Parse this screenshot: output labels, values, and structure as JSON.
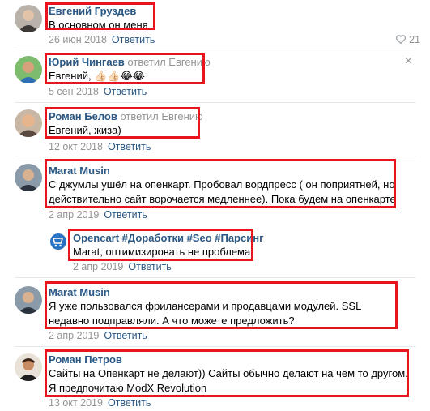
{
  "comments": [
    {
      "author": "Евгений Груздев",
      "reply_to": "",
      "text": "В основном он меня",
      "date": "26 июн 2018",
      "action": "Ответить",
      "likes": "21"
    },
    {
      "author": "Юрий Чингаев",
      "reply_to": "ответил Евгению",
      "text": "Евгений,",
      "emojis": [
        "👍🏻",
        "👍🏻",
        "😂",
        "😂"
      ],
      "date": "5 сен 2018",
      "action": "Ответить",
      "close": "×"
    },
    {
      "author": "Роман Белов",
      "reply_to": "ответил Евгению",
      "text": "Евгений, жиза)",
      "date": "12 окт 2018",
      "action": "Ответить"
    },
    {
      "author": "Marat Musin",
      "reply_to": "",
      "text": "С джумлы ушёл на опенкарт. Пробовал вордпресс ( он поприятней, но действительно сайт ворочается медленнее). Пока будем на опенкарте",
      "date": "2 апр 2019",
      "action": "Ответить"
    },
    {
      "author": "Opencart #Доработки #Seo #Парсинг",
      "reply_to": "",
      "text": "Marat, оптимизировать не проблема",
      "date": "2 апр 2019",
      "action": "Ответить"
    },
    {
      "author": "Marat Musin",
      "reply_to": "",
      "text": "Я уже пользовался фрилансерами и продавцами модулей. SSL недавно подправляли. А что можете предложить?",
      "date": "2 апр 2019",
      "action": "Ответить"
    },
    {
      "author": "Роман Петров",
      "reply_to": "",
      "text": "Сайты на Опенкарт не делают)) Сайты обычно делают на чём то другом. Я предпочитаю ModX Revolution",
      "date": "13 окт 2019",
      "action": "Ответить"
    }
  ],
  "colors": {
    "link": "#2a5885",
    "meta": "#939393",
    "highlight": "#e8141e",
    "divider": "#e7e8ec"
  },
  "icons": [
    "heart-icon",
    "close-icon",
    "avatar"
  ]
}
